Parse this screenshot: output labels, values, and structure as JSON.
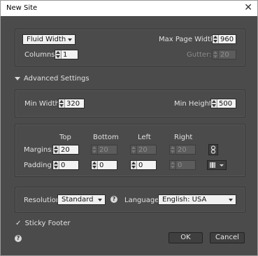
{
  "window": {
    "title": "New Site"
  },
  "layout": {
    "type_select": "Fluid Width",
    "max_page_width_label": "Max Page Width:",
    "max_page_width_value": "960",
    "columns_label": "Columns:",
    "columns_value": "1",
    "gutter_label": "Gutter:",
    "gutter_value": "20"
  },
  "advanced": {
    "label": "Advanced Settings"
  },
  "size": {
    "min_width_label": "Min Width:",
    "min_width_value": "320",
    "min_height_label": "Min Height:",
    "min_height_value": "500"
  },
  "spacing": {
    "col_top": "Top",
    "col_bottom": "Bottom",
    "col_left": "Left",
    "col_right": "Right",
    "margins_label": "Margins:",
    "margins": [
      "20",
      "20",
      "20",
      "20"
    ],
    "padding_label": "Padding:",
    "padding": [
      "0",
      "0",
      "0",
      "0"
    ]
  },
  "output": {
    "resolution_label": "Resolution:",
    "resolution_value": "Standard",
    "language_label": "Language:",
    "language_value": "English: USA"
  },
  "footer": {
    "sticky_label": "Sticky Footer",
    "ok_label": "OK",
    "cancel_label": "Cancel"
  }
}
